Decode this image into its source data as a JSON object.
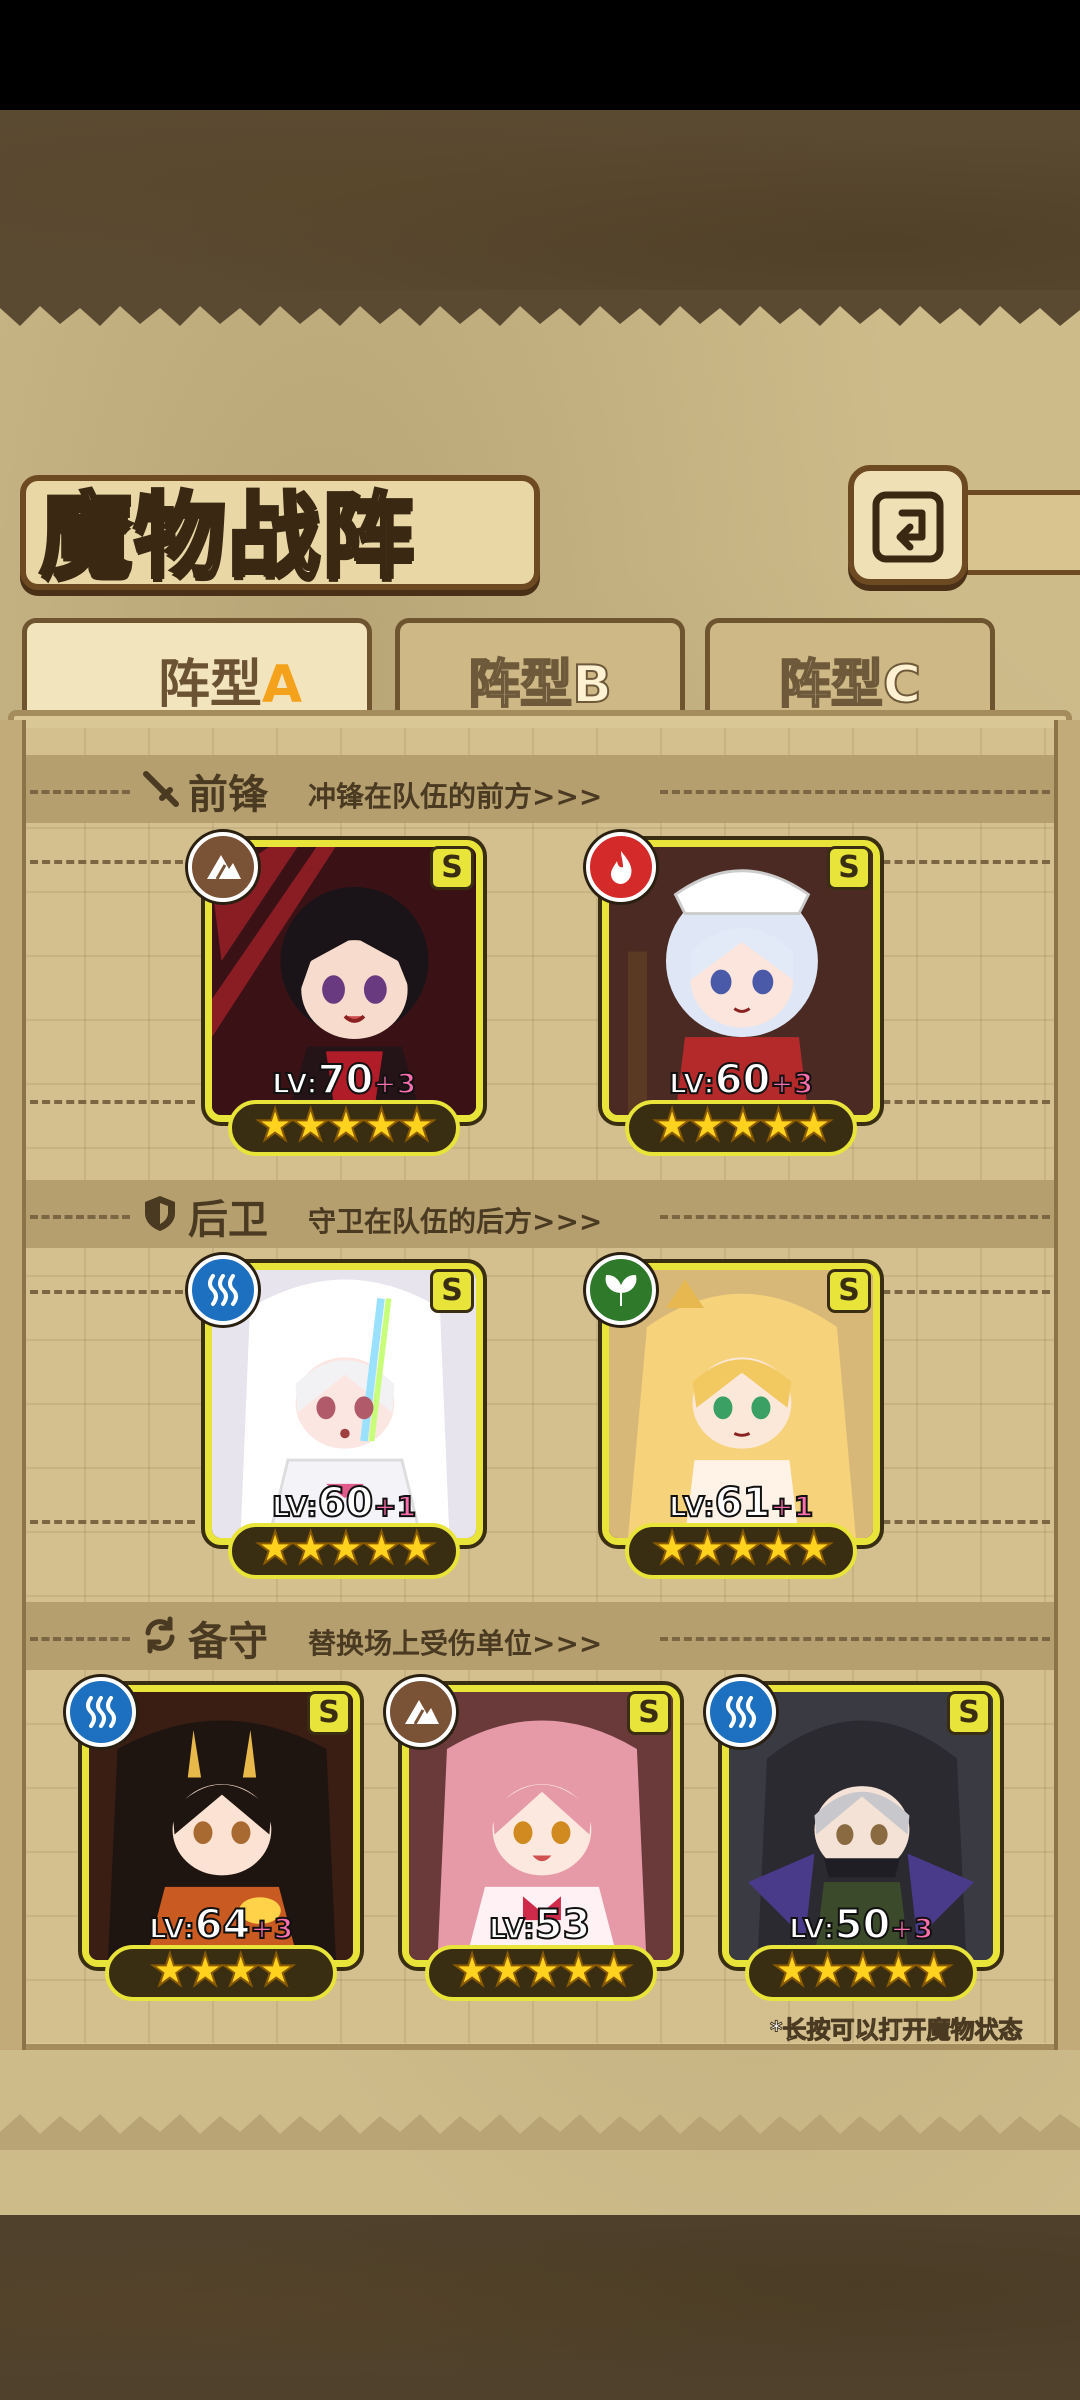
{
  "title": "魔物战阵",
  "tabs": [
    {
      "prefix": "阵型",
      "letter": "A",
      "active": true
    },
    {
      "prefix": "阵型",
      "letter": "B",
      "active": false
    },
    {
      "prefix": "阵型",
      "letter": "C",
      "active": false
    }
  ],
  "sections": {
    "front": {
      "name": "前锋",
      "desc": "冲锋在队伍的前方>>>"
    },
    "rear": {
      "name": "后卫",
      "desc": "守卫在队伍的后方>>>"
    },
    "reserve": {
      "name": "备守",
      "desc": "替换场上受伤单位>>>"
    }
  },
  "cards": {
    "front_1": {
      "rank": "S",
      "element": "earth",
      "lv_prefix": "LV:",
      "level": "70",
      "plus": "+3",
      "stars": "★★★★★"
    },
    "front_2": {
      "rank": "S",
      "element": "fire",
      "lv_prefix": "LV:",
      "level": "60",
      "plus": "+3",
      "stars": "★★★★★"
    },
    "rear_1": {
      "rank": "S",
      "element": "water",
      "lv_prefix": "LV:",
      "level": "60",
      "plus": "+1",
      "stars": "★★★★★"
    },
    "rear_2": {
      "rank": "S",
      "element": "wood",
      "lv_prefix": "LV:",
      "level": "61",
      "plus": "+1",
      "stars": "★★★★★"
    },
    "reserve_1": {
      "rank": "S",
      "element": "water",
      "lv_prefix": "LV:",
      "level": "64",
      "plus": "+3",
      "stars": "★★★★"
    },
    "reserve_2": {
      "rank": "S",
      "element": "earth",
      "lv_prefix": "LV:",
      "level": "53",
      "plus": "",
      "stars": "★★★★★"
    },
    "reserve_3": {
      "rank": "S",
      "element": "water",
      "lv_prefix": "LV:",
      "level": "50",
      "plus": "+3",
      "stars": "★★★★★"
    }
  },
  "footnote": "*长按可以打开魔物状态",
  "colors": {
    "frame_gold": "#e9e43a",
    "earth": "#7a5236",
    "fire": "#d42a2a",
    "water": "#1d6fc0",
    "wood": "#2f7a2a",
    "plus_pink": "#ff6fb0",
    "star": "#ffd21e"
  }
}
